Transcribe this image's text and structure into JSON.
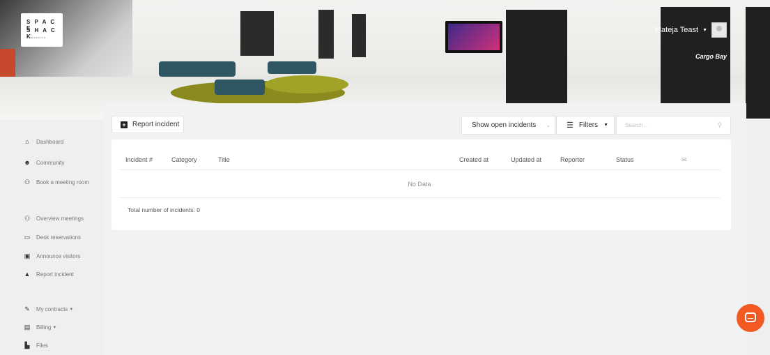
{
  "header": {
    "logo_line1": "S P A C E",
    "logo_line2": "S H A C K",
    "logo_line3": "COWORKING",
    "user_name": "Mateja Teast",
    "sign_text": "Cargo Bay"
  },
  "sidebar": {
    "items": [
      {
        "label": "Dashboard",
        "icon": "home-icon"
      },
      {
        "label": "Community",
        "icon": "community-icon"
      },
      {
        "label": "Book a meeting room",
        "icon": "meeting-room-icon"
      },
      {
        "label": "Overview meetings",
        "icon": "meetings-overview-icon"
      },
      {
        "label": "Desk reservations",
        "icon": "desk-icon"
      },
      {
        "label": "Announce visitors",
        "icon": "visitor-card-icon"
      },
      {
        "label": "Report incident",
        "icon": "warning-icon"
      },
      {
        "label": "My contracts",
        "icon": "contract-icon"
      },
      {
        "label": "Billing",
        "icon": "credit-card-icon"
      },
      {
        "label": "Files",
        "icon": "file-icon"
      }
    ]
  },
  "toolbar": {
    "report_label": "Report incident",
    "filter_select_value": "Show open incidents",
    "filters_label": "Filters",
    "search_placeholder": "Search..."
  },
  "table": {
    "columns": [
      "Incident #",
      "Category",
      "Title",
      "Created at",
      "Updated at",
      "Reporter",
      "Status"
    ],
    "empty_text": "No Data",
    "total_text": "Total number of incidents: 0"
  },
  "colors": {
    "accent": "#f15a22",
    "page_bg": "#efefef",
    "card_bg": "#ffffff"
  }
}
